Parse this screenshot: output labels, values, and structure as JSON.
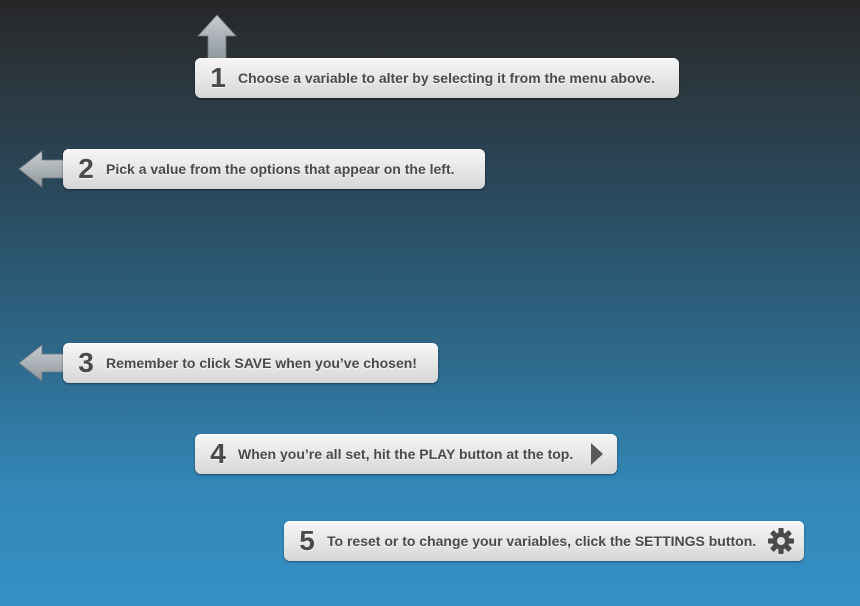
{
  "steps": [
    {
      "number": "1",
      "text": "Choose a variable to alter by selecting it from the menu above.",
      "pointer": "arrow-up-icon"
    },
    {
      "number": "2",
      "text": "Pick a value from the options that appear on the left.",
      "pointer": "arrow-left-icon"
    },
    {
      "number": "3",
      "text": "Remember to click SAVE when you’ve chosen!",
      "pointer": "arrow-left-icon"
    },
    {
      "number": "4",
      "text": "When you’re all set, hit the PLAY button at the top.",
      "trailing_icon": "play-icon"
    },
    {
      "number": "5",
      "text": "To reset or to change your variables, click the SETTINGS button.",
      "trailing_icon": "gear-icon"
    }
  ],
  "colors": {
    "background_top": "#262628",
    "background_bottom": "#3591c6",
    "tip_background": "#e6e6e6",
    "tip_text": "#4a4a4a",
    "arrow_fill": "#b9bfc3"
  }
}
